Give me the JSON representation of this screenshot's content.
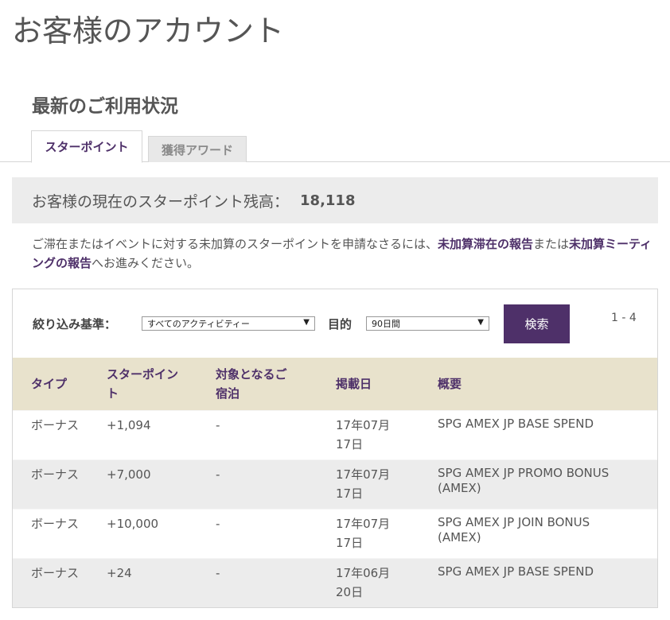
{
  "page_title": "お客様のアカウント",
  "section_title": "最新のご利用状況",
  "tabs": [
    {
      "label": "スターポイント",
      "active": true
    },
    {
      "label": "獲得アワード",
      "active": false
    }
  ],
  "balance": {
    "label": "お客様の現在のスターポイント残高：",
    "value": "18,118"
  },
  "note": {
    "text_before": "ご滞在またはイベントに対する未加算のスターポイントを申請なさるには、",
    "link1": "未加算滞在の報告",
    "text_middle": "または",
    "link2": "未加算ミーティングの報告",
    "text_after": "へお進みください。"
  },
  "filter": {
    "label": "絞り込み基準：",
    "activity_selected": "すべてのアクティビティー",
    "period_label": "目的",
    "period_selected": "90日間",
    "search_label": "検索",
    "range_text": "1 - 4"
  },
  "table": {
    "headers": [
      "タイプ",
      "スターポイント",
      "対象となるご宿泊",
      "掲載日",
      "概要"
    ],
    "rows": [
      {
        "type": "ボーナス",
        "points": "+1,094",
        "stay": "-",
        "date": "17年07月17日",
        "summary": "SPG AMEX JP BASE SPEND"
      },
      {
        "type": "ボーナス",
        "points": "+7,000",
        "stay": "-",
        "date": "17年07月17日",
        "summary": "SPG AMEX JP PROMO BONUS (AMEX)"
      },
      {
        "type": "ボーナス",
        "points": "+10,000",
        "stay": "-",
        "date": "17年07月17日",
        "summary": "SPG AMEX JP JOIN BONUS (AMEX)"
      },
      {
        "type": "ボーナス",
        "points": "+24",
        "stay": "-",
        "date": "17年06月20日",
        "summary": "SPG AMEX JP BASE SPEND"
      }
    ]
  },
  "colors": {
    "accent": "#4e3069",
    "header_bg": "#e8e2cc",
    "balance_bg": "#ececec"
  }
}
